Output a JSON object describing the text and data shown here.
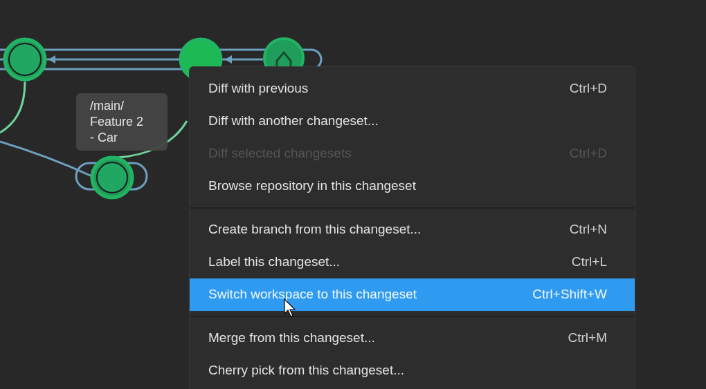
{
  "graph": {
    "tooltip": "/main/ Feature 2 - Car"
  },
  "context_menu": {
    "items": [
      {
        "kind": "item",
        "label": "Diff with previous",
        "shortcut": "Ctrl+D",
        "disabled": false,
        "selected": false
      },
      {
        "kind": "item",
        "label": "Diff with another changeset...",
        "disabled": false,
        "selected": false
      },
      {
        "kind": "item",
        "label": "Diff selected changesets",
        "shortcut": "Ctrl+D",
        "disabled": true,
        "selected": false
      },
      {
        "kind": "item",
        "label": "Browse repository in this changeset",
        "disabled": false,
        "selected": false
      },
      {
        "kind": "separator"
      },
      {
        "kind": "item",
        "label": "Create branch from this changeset...",
        "shortcut": "Ctrl+N",
        "disabled": false,
        "selected": false
      },
      {
        "kind": "item",
        "label": "Label this changeset...",
        "shortcut": "Ctrl+L",
        "disabled": false,
        "selected": false
      },
      {
        "kind": "item",
        "label": "Switch workspace to this changeset",
        "shortcut": "Ctrl+Shift+W",
        "disabled": false,
        "selected": true
      },
      {
        "kind": "separator"
      },
      {
        "kind": "item",
        "label": "Merge from this changeset...",
        "shortcut": "Ctrl+M",
        "disabled": false,
        "selected": false
      },
      {
        "kind": "item",
        "label": "Cherry pick from this changeset...",
        "disabled": false,
        "selected": false
      }
    ]
  }
}
